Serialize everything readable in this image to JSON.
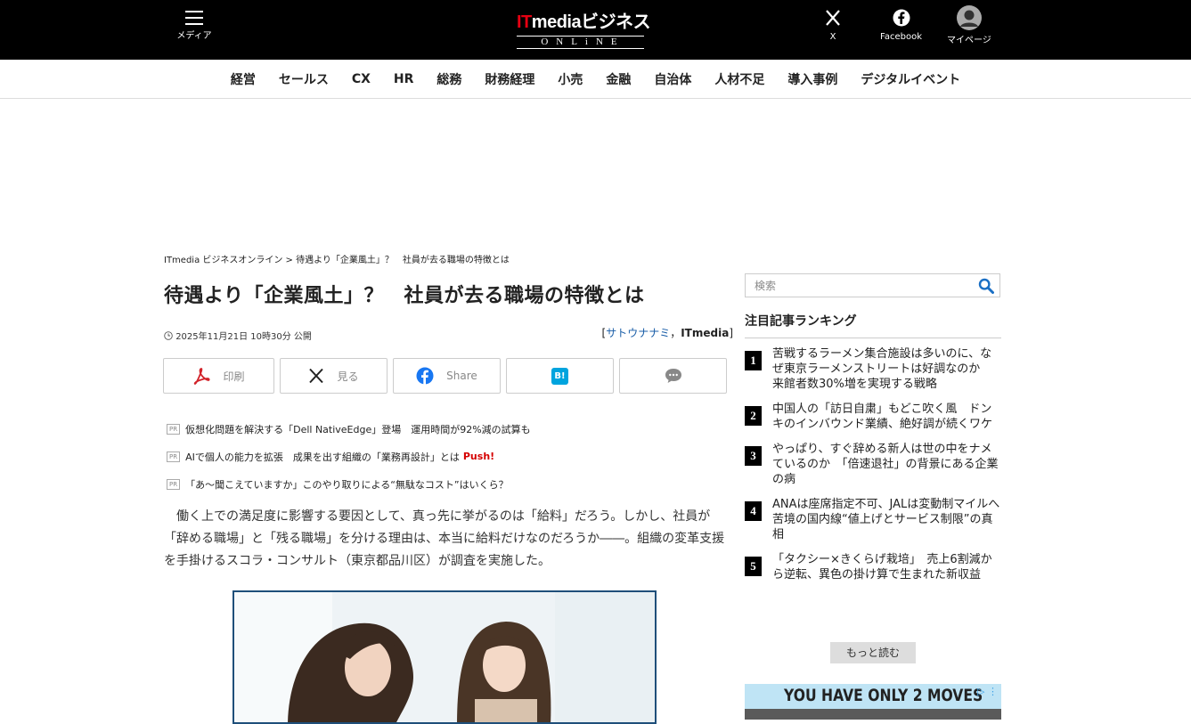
{
  "header": {
    "menu_label": "メディア",
    "logo_main_it": "IT",
    "logo_main_rest": "mediaビジネス",
    "logo_sub": "ONLiNE",
    "x_label": "X",
    "facebook_label": "Facebook",
    "mypage_label": "マイページ"
  },
  "nav": [
    "経営",
    "セールス",
    "CX",
    "HR",
    "総務",
    "財務経理",
    "小売",
    "金融",
    "自治体",
    "人材不足",
    "導入事例",
    "デジタルイベント"
  ],
  "article": {
    "breadcrumb": "ITmedia ビジネスオンライン > 待遇より「企業風土」？　社員が去る職場の特徴とは",
    "title": "待遇より「企業風土」？　社員が去る職場の特徴とは",
    "date": "2025年11月21日 10時30分 公開",
    "author_prefix": "[",
    "author_name": "サトウナナミ",
    "author_sep": "，",
    "author_org": "ITmedia",
    "author_suffix": "]",
    "share": {
      "print_label": "印刷",
      "x_label": "見る",
      "facebook_label": "Share",
      "hatena_label": "B!"
    },
    "pr_badge": "PR",
    "pr_items": [
      {
        "text": "仮想化問題を解決する「Dell NativeEdge」登場　運用時間が92%減の試算も",
        "push": ""
      },
      {
        "text": "AIで個人の能力を拡張　成果を出す組織の「業務再設計」とは",
        "push": "Push!"
      },
      {
        "text": "「あ～聞こえていますか」このやり取りによる“無駄なコスト”はいくら？",
        "push": ""
      }
    ],
    "lead": "　働く上での満足度に影響する要因として、真っ先に挙がるのは「給料」だろう。しかし、社員が「辞める職場」と「残る職場」を分ける理由は、本当に給料だけなのだろうか――。組織の変革支援を手掛けるスコラ・コンサルト（東京都品川区）が調査を実施した。"
  },
  "sidebar": {
    "search_placeholder": "検索",
    "ranking_title": "注目記事ランキング",
    "ranking": [
      {
        "num": "1",
        "text": "苦戦するラーメン集合施設は多いのに、なぜ東京ラーメンストリートは好調なのか　来館者数30%増を実現する戦略"
      },
      {
        "num": "2",
        "text": "中国人の「訪日自粛」もどこ吹く風　ドンキのインバウンド業績、絶好調が続くワケ"
      },
      {
        "num": "3",
        "text": "やっぱり、すぐ辞める新人は世の中をナメているのか　「倍速退社」の背景にある企業の病"
      },
      {
        "num": "4",
        "text": "ANAは座席指定不可、JALは変動制マイルへ　苦境の国内線“値上げとサービス制限”の真相"
      },
      {
        "num": "5",
        "text": "「タクシー×きくらげ栽培」　売上6割減から逆転、異色の掛け算で生まれた新収益"
      }
    ],
    "more_label": "もっと読む",
    "ad_text": "YOU HAVE ONLY 2 MOVES"
  },
  "colors": {
    "header_bg": "#000000",
    "logo_accent": "#e60012",
    "link": "#1a5ea8",
    "push": "#d50000"
  }
}
